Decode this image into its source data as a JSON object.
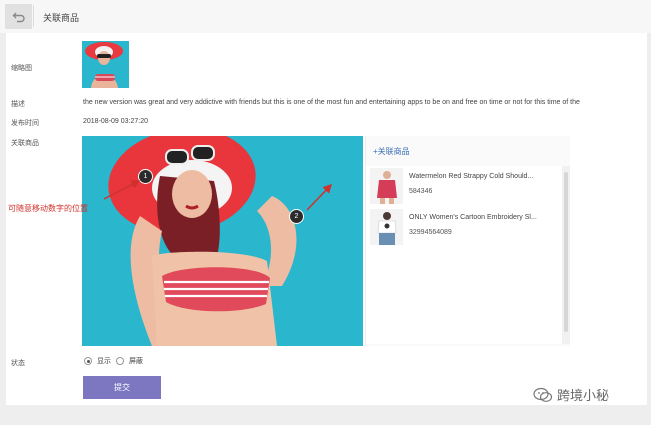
{
  "header": {
    "title": "关联商品"
  },
  "form": {
    "thumbnail_label": "缩略图",
    "description_label": "描述",
    "description": "the new version was great and very addictive with friends but this is one of the most fun and entertaining apps to be on and free on time or not for this time of the",
    "publish_time_label": "发布时间",
    "publish_time": "2018-08-09 03:27:20",
    "related_label": "关联商品",
    "status_label": "状态",
    "status_options": [
      "显示",
      "屏蔽"
    ],
    "status_selected": "显示",
    "submit_label": "提交"
  },
  "annotation": {
    "callout": "可随意移动数字的位置"
  },
  "markers": [
    "1",
    "2"
  ],
  "related": {
    "add_label": "+关联商品",
    "products": [
      {
        "title": "Watermelon Red Strappy Cold Should...",
        "id": "584346"
      },
      {
        "title": "ONLY Women's Cartoon Embroidery Sl...",
        "id": "32994564089"
      }
    ]
  },
  "watermark": {
    "text": "跨境小秘"
  },
  "colors": {
    "submit": "#7d77c2",
    "link": "#3b6fb6",
    "callout": "#d0312d",
    "photo_bg": "#2ab6cc"
  }
}
